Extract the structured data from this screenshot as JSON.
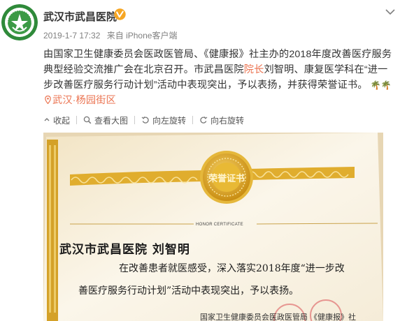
{
  "post": {
    "user_name": "武汉市武昌医院",
    "verified_badge": "verified-icon",
    "time": "2019-1-7 17:32",
    "source": "来自 iPhone客户端",
    "text_part1": "由国家卫生健康委员会医政医管局、《健康报》社主办的2018年度改善医疗服务典型经验交流推广会在北京召开。市武昌医院",
    "text_highlight": "院长",
    "text_part2": "刘智明、康复医学科在“进一步改善医疗服务行动计划”活动中表现突出，予以表扬，并获得荣誉证书。",
    "location": "武汉·杨园街区",
    "location_icon": "location-pin-icon"
  },
  "toolbar": {
    "collapse_label": "收起",
    "view_large_label": "查看大图",
    "rotate_left_label": "向左旋转",
    "rotate_right_label": "向右旋转"
  },
  "certificate": {
    "seal_text": "荣誉证书",
    "honor_label": "HONOR CERTIFICATE",
    "recipient": "武汉市武昌医院  刘智明",
    "body_line1": "在改善患者就医感受，深入落实2018年度“进一步改",
    "body_line2": "善医疗服务行动计划”活动中表现突出，予以表扬。",
    "issuer": "国家卫生健康委员会医政医管局 《健康报》社"
  },
  "colors": {
    "accent": "#eb7350",
    "verified": "#f6a623",
    "gold": "#d9a21b"
  }
}
